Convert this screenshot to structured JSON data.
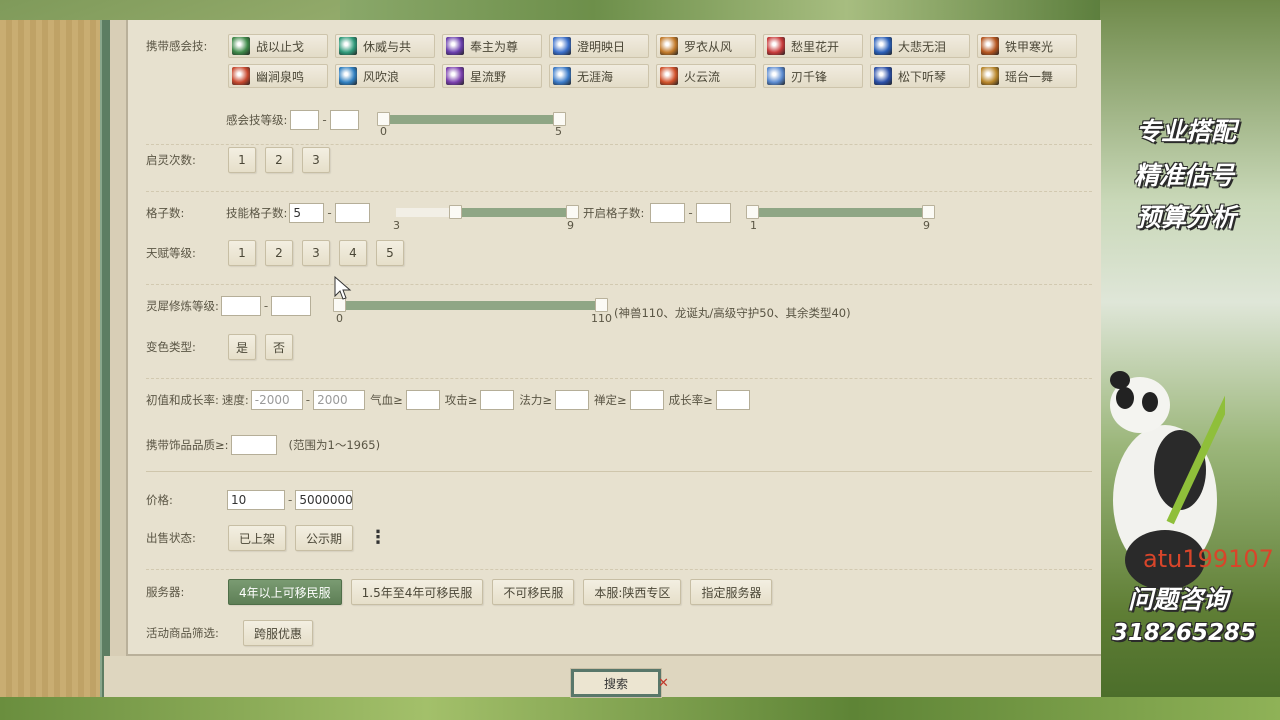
{
  "skills": {
    "label": "携带感会技:",
    "row1": [
      {
        "name": "战以止戈",
        "color": "#3f8a4a"
      },
      {
        "name": "休威与共",
        "color": "#2f9a7a"
      },
      {
        "name": "奉主为尊",
        "color": "#6a3fae"
      },
      {
        "name": "澄明映日",
        "color": "#3a6ec9"
      },
      {
        "name": "罗衣从风",
        "color": "#c27a2a"
      },
      {
        "name": "愁里花开",
        "color": "#c83a3a"
      },
      {
        "name": "大悲无泪",
        "color": "#2a5fb8"
      },
      {
        "name": "铁甲寒光",
        "color": "#b5551f"
      }
    ],
    "row2": [
      {
        "name": "幽涧泉鸣",
        "color": "#c8482e"
      },
      {
        "name": "风吹浪",
        "color": "#2f7fc0"
      },
      {
        "name": "星流野",
        "color": "#7a3fae"
      },
      {
        "name": "无涯海",
        "color": "#3a7ac8"
      },
      {
        "name": "火云流",
        "color": "#d0502a"
      },
      {
        "name": "刃千锋",
        "color": "#5a8ad0"
      },
      {
        "name": "松下听琴",
        "color": "#2a4fa8"
      },
      {
        "name": "瑶台一舞",
        "color": "#b8862a"
      }
    ]
  },
  "skill_level": {
    "label": "感会技等级:",
    "min_value": "",
    "max_value": "",
    "range_min": "0",
    "range_max": "5",
    "low": 0,
    "high": 5
  },
  "awaken": {
    "label": "启灵次数:",
    "options": [
      "1",
      "2",
      "3"
    ]
  },
  "slots": {
    "label": "格子数:",
    "skill_label": "技能格子数:",
    "skill_min": "5",
    "skill_max": "",
    "skill_range_min": "3",
    "skill_range_max": "9",
    "skill_low": 5,
    "skill_high": 9,
    "open_label": "开启格子数:",
    "open_min": "",
    "open_max": "",
    "open_range_min": "1",
    "open_range_max": "9",
    "open_low": 1,
    "open_high": 9
  },
  "talent": {
    "label": "天赋等级:",
    "options": [
      "1",
      "2",
      "3",
      "4",
      "5"
    ]
  },
  "cultivate": {
    "label": "灵犀修炼等级:",
    "min_value": "",
    "max_value": "",
    "range_min": "0",
    "range_max": "110",
    "low": 0,
    "high": 110,
    "note": "(神兽110、龙诞丸/高级守护50、其余类型40)"
  },
  "color_change": {
    "label": "变色类型:",
    "yes": "是",
    "no": "否"
  },
  "initial": {
    "label": "初值和成长率:",
    "speed_label": "速度:",
    "speed_min_placeholder": "-2000",
    "speed_max_placeholder": "2000",
    "hp_label": "气血≥",
    "atk_label": "攻击≥",
    "magic_label": "法力≥",
    "zen_label": "禅定≥",
    "growth_label": "成长率≥"
  },
  "ornament": {
    "label": "携带饰品品质≥:",
    "value": "",
    "note": "(范围为1～1965)"
  },
  "price": {
    "label": "价格:",
    "min": "10",
    "max": "5000000"
  },
  "sale_status": {
    "label": "出售状态:",
    "options": [
      "已上架",
      "公示期"
    ]
  },
  "server": {
    "label": "服务器:",
    "options": [
      "4年以上可移民服",
      "1.5年至4年可移民服",
      "不可移民服",
      "本服:陕西专区",
      "指定服务器"
    ],
    "active_index": 0
  },
  "activity": {
    "label": "活动商品筛选:",
    "option": "跨服优惠"
  },
  "search_label": "搜索",
  "search_close": "✕",
  "more_label": "⋮",
  "promo": {
    "line1": "专业搭配",
    "line2": "精准估号",
    "line3": "预算分析",
    "contact_id": "atu199107",
    "line4": "问题咨询",
    "qq": "318265285"
  }
}
